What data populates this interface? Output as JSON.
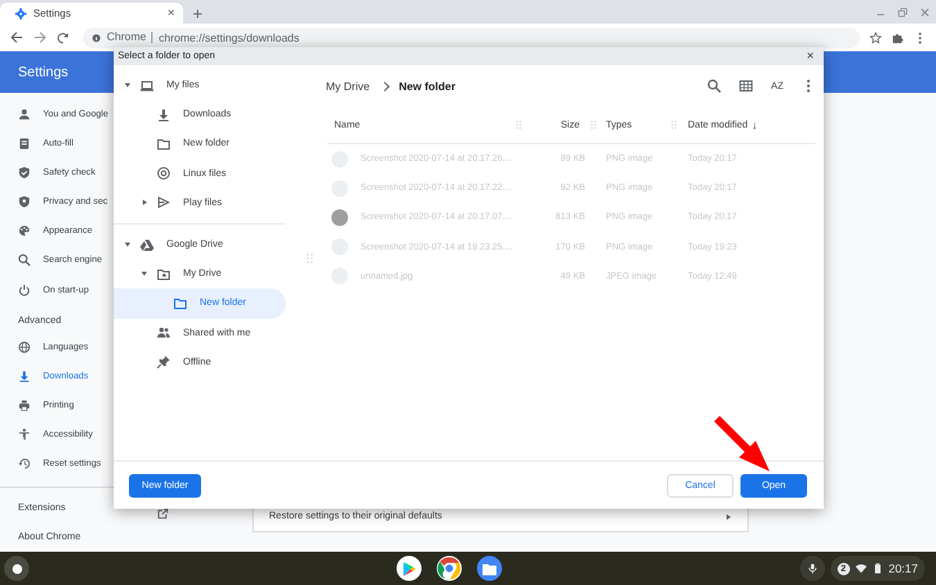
{
  "browser": {
    "tab": {
      "title": "Settings",
      "close": "×",
      "selected": true
    },
    "new_tab": "+",
    "omnibox": {
      "site": "Chrome",
      "url": "chrome://settings/downloads"
    }
  },
  "settings": {
    "title": "Settings",
    "nav": [
      {
        "label": "You and Google",
        "selected": false
      },
      {
        "label": "Auto-fill",
        "selected": false
      },
      {
        "label": "Safety check",
        "selected": false
      },
      {
        "label": "Privacy and sec",
        "selected": false
      },
      {
        "label": "Appearance",
        "selected": false
      },
      {
        "label": "Search engine",
        "selected": false
      },
      {
        "label": "On start-up",
        "selected": false
      }
    ],
    "advanced": {
      "title": "Advanced",
      "items": [
        {
          "label": "Languages",
          "selected": false
        },
        {
          "label": "Downloads",
          "selected": true
        },
        {
          "label": "Printing",
          "selected": false
        },
        {
          "label": "Accessibility",
          "selected": false
        },
        {
          "label": "Reset settings",
          "selected": false
        }
      ]
    },
    "links": [
      "Extensions",
      "About Chrome"
    ],
    "reset_card": "Restore settings to their original defaults"
  },
  "dialog": {
    "title": "Select a folder to open",
    "close": "×",
    "tree": [
      {
        "label": "My files",
        "expanded": true,
        "selected": false,
        "children": [
          {
            "label": "Downloads",
            "selected": false
          },
          {
            "label": "New folder",
            "selected": false
          },
          {
            "label": "Linux files",
            "selected": false
          },
          {
            "label": "Play files",
            "expanded": false,
            "selected": false
          }
        ]
      },
      {
        "label": "Google Drive",
        "expanded": true,
        "selected": false,
        "children": [
          {
            "label": "My Drive",
            "expanded": true,
            "selected": false,
            "children": [
              {
                "label": "New folder",
                "selected": true
              }
            ]
          },
          {
            "label": "Shared with me",
            "selected": false
          },
          {
            "label": "Offline",
            "selected": false
          }
        ]
      }
    ],
    "breadcrumb": [
      "My Drive",
      "New folder"
    ],
    "sort_label": "AZ",
    "columns": [
      "Name",
      "Size",
      "Types",
      "Date modified"
    ],
    "sort_arrow": "↓",
    "files": [
      {
        "name": "Screenshot 2020-07-14 at 20.17.26....",
        "size": "89 KB",
        "type": "PNG image",
        "date": "Today 20:17",
        "disabled": true
      },
      {
        "name": "Screenshot 2020-07-14 at 20.17.22....",
        "size": "92 KB",
        "type": "PNG image",
        "date": "Today 20:17",
        "disabled": true
      },
      {
        "name": "Screenshot 2020-07-14 at 20.17.07....",
        "size": "813 KB",
        "type": "PNG image",
        "date": "Today 20:17",
        "disabled": true
      },
      {
        "name": "Screenshot 2020-07-14 at 19.23.25....",
        "size": "170 KB",
        "type": "PNG image",
        "date": "Today 19:23",
        "disabled": true
      },
      {
        "name": "unnamed.jpg",
        "size": "49 KB",
        "type": "JPEG image",
        "date": "Today 12:49",
        "disabled": true
      }
    ],
    "buttons": {
      "new_folder": "New folder",
      "cancel": "Cancel",
      "open": "Open"
    }
  },
  "shelf": {
    "notifications": "2",
    "time": "20:17"
  }
}
